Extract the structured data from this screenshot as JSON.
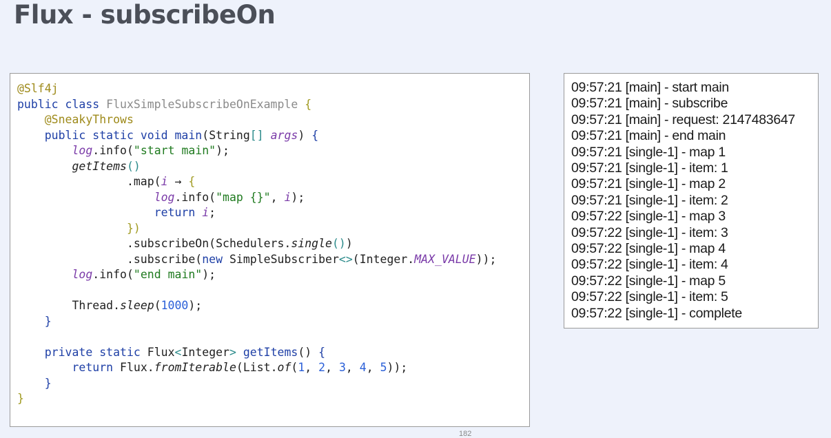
{
  "slide": {
    "title": "Flux - subscribeOn",
    "page_number": "182"
  },
  "code": {
    "lines": [
      [
        {
          "t": "@Slf4j",
          "c": "ann"
        }
      ],
      [
        {
          "t": "public class ",
          "c": "kw"
        },
        {
          "t": "FluxSimpleSubscribeOnExample",
          "c": "cls-gray"
        },
        {
          "t": " "
        },
        {
          "t": "{",
          "c": "brk1"
        }
      ],
      [
        {
          "t": "    "
        },
        {
          "t": "@SneakyThrows",
          "c": "ann"
        }
      ],
      [
        {
          "t": "    "
        },
        {
          "t": "public static void ",
          "c": "kw"
        },
        {
          "t": "main",
          "c": "kw"
        },
        {
          "t": "("
        },
        {
          "t": "String"
        },
        {
          "t": "[]",
          "c": "brk2"
        },
        {
          "t": " "
        },
        {
          "t": "args",
          "c": "param"
        },
        {
          "t": ") "
        },
        {
          "t": "{",
          "c": "kw"
        }
      ],
      [
        {
          "t": "        "
        },
        {
          "t": "log",
          "c": "field"
        },
        {
          "t": ".info("
        },
        {
          "t": "\"start main\"",
          "c": "str"
        },
        {
          "t": ");"
        }
      ],
      [
        {
          "t": "        "
        },
        {
          "t": "getItems",
          "c": "it"
        },
        {
          "t": "()",
          "c": "brk2"
        }
      ],
      [
        {
          "t": "                .map("
        },
        {
          "t": "i",
          "c": "param"
        },
        {
          "t": " → "
        },
        {
          "t": "{",
          "c": "brk1"
        }
      ],
      [
        {
          "t": "                    "
        },
        {
          "t": "log",
          "c": "field"
        },
        {
          "t": ".info("
        },
        {
          "t": "\"map {}\"",
          "c": "str"
        },
        {
          "t": ", "
        },
        {
          "t": "i",
          "c": "param"
        },
        {
          "t": ");"
        }
      ],
      [
        {
          "t": "                    "
        },
        {
          "t": "return ",
          "c": "kw"
        },
        {
          "t": "i",
          "c": "param"
        },
        {
          "t": ";"
        }
      ],
      [
        {
          "t": "                "
        },
        {
          "t": "})",
          "c": "brk1"
        }
      ],
      [
        {
          "t": "                .subscribeOn(Schedulers."
        },
        {
          "t": "single",
          "c": "it"
        },
        {
          "t": "()",
          "c": "brk2"
        },
        {
          "t": ")"
        }
      ],
      [
        {
          "t": "                .subscribe("
        },
        {
          "t": "new ",
          "c": "kw"
        },
        {
          "t": "SimpleSubscriber"
        },
        {
          "t": "<>",
          "c": "brk2"
        },
        {
          "t": "(Integer."
        },
        {
          "t": "MAX_VALUE",
          "c": "field"
        },
        {
          "t": "));"
        }
      ],
      [
        {
          "t": "        "
        },
        {
          "t": "log",
          "c": "field"
        },
        {
          "t": ".info("
        },
        {
          "t": "\"end main\"",
          "c": "str"
        },
        {
          "t": ");"
        }
      ],
      [
        {
          "t": ""
        }
      ],
      [
        {
          "t": "        Thread."
        },
        {
          "t": "sleep",
          "c": "it"
        },
        {
          "t": "("
        },
        {
          "t": "1000",
          "c": "num"
        },
        {
          "t": ");"
        }
      ],
      [
        {
          "t": "    "
        },
        {
          "t": "}",
          "c": "kw"
        }
      ],
      [
        {
          "t": ""
        }
      ],
      [
        {
          "t": "    "
        },
        {
          "t": "private static ",
          "c": "kw"
        },
        {
          "t": "Flux"
        },
        {
          "t": "<",
          "c": "brk2"
        },
        {
          "t": "Integer"
        },
        {
          "t": ">",
          "c": "brk2"
        },
        {
          "t": " "
        },
        {
          "t": "getItems",
          "c": "kw"
        },
        {
          "t": "() "
        },
        {
          "t": "{",
          "c": "kw"
        }
      ],
      [
        {
          "t": "        "
        },
        {
          "t": "return ",
          "c": "kw"
        },
        {
          "t": "Flux."
        },
        {
          "t": "fromIterable",
          "c": "it"
        },
        {
          "t": "(List."
        },
        {
          "t": "of",
          "c": "it"
        },
        {
          "t": "("
        },
        {
          "t": "1",
          "c": "num"
        },
        {
          "t": ", "
        },
        {
          "t": "2",
          "c": "num"
        },
        {
          "t": ", "
        },
        {
          "t": "3",
          "c": "num"
        },
        {
          "t": ", "
        },
        {
          "t": "4",
          "c": "num"
        },
        {
          "t": ", "
        },
        {
          "t": "5",
          "c": "num"
        },
        {
          "t": "));"
        }
      ],
      [
        {
          "t": "    "
        },
        {
          "t": "}",
          "c": "kw"
        }
      ],
      [
        {
          "t": "}",
          "c": "brk1"
        }
      ]
    ]
  },
  "log_output": {
    "lines": [
      "09:57:21 [main] - start main",
      "09:57:21 [main] - subscribe",
      "09:57:21 [main] - request: 2147483647",
      "09:57:21 [main] - end main",
      "09:57:21 [single-1] - map 1",
      "09:57:21 [single-1] - item: 1",
      "09:57:21 [single-1] - map 2",
      "09:57:21 [single-1] - item: 2",
      "09:57:22 [single-1] - map 3",
      "09:57:22 [single-1] - item: 3",
      "09:57:22 [single-1] - map 4",
      "09:57:22 [single-1] - item: 4",
      "09:57:22 [single-1] - map 5",
      "09:57:22 [single-1] - item: 5",
      "09:57:22 [single-1] - complete"
    ]
  }
}
